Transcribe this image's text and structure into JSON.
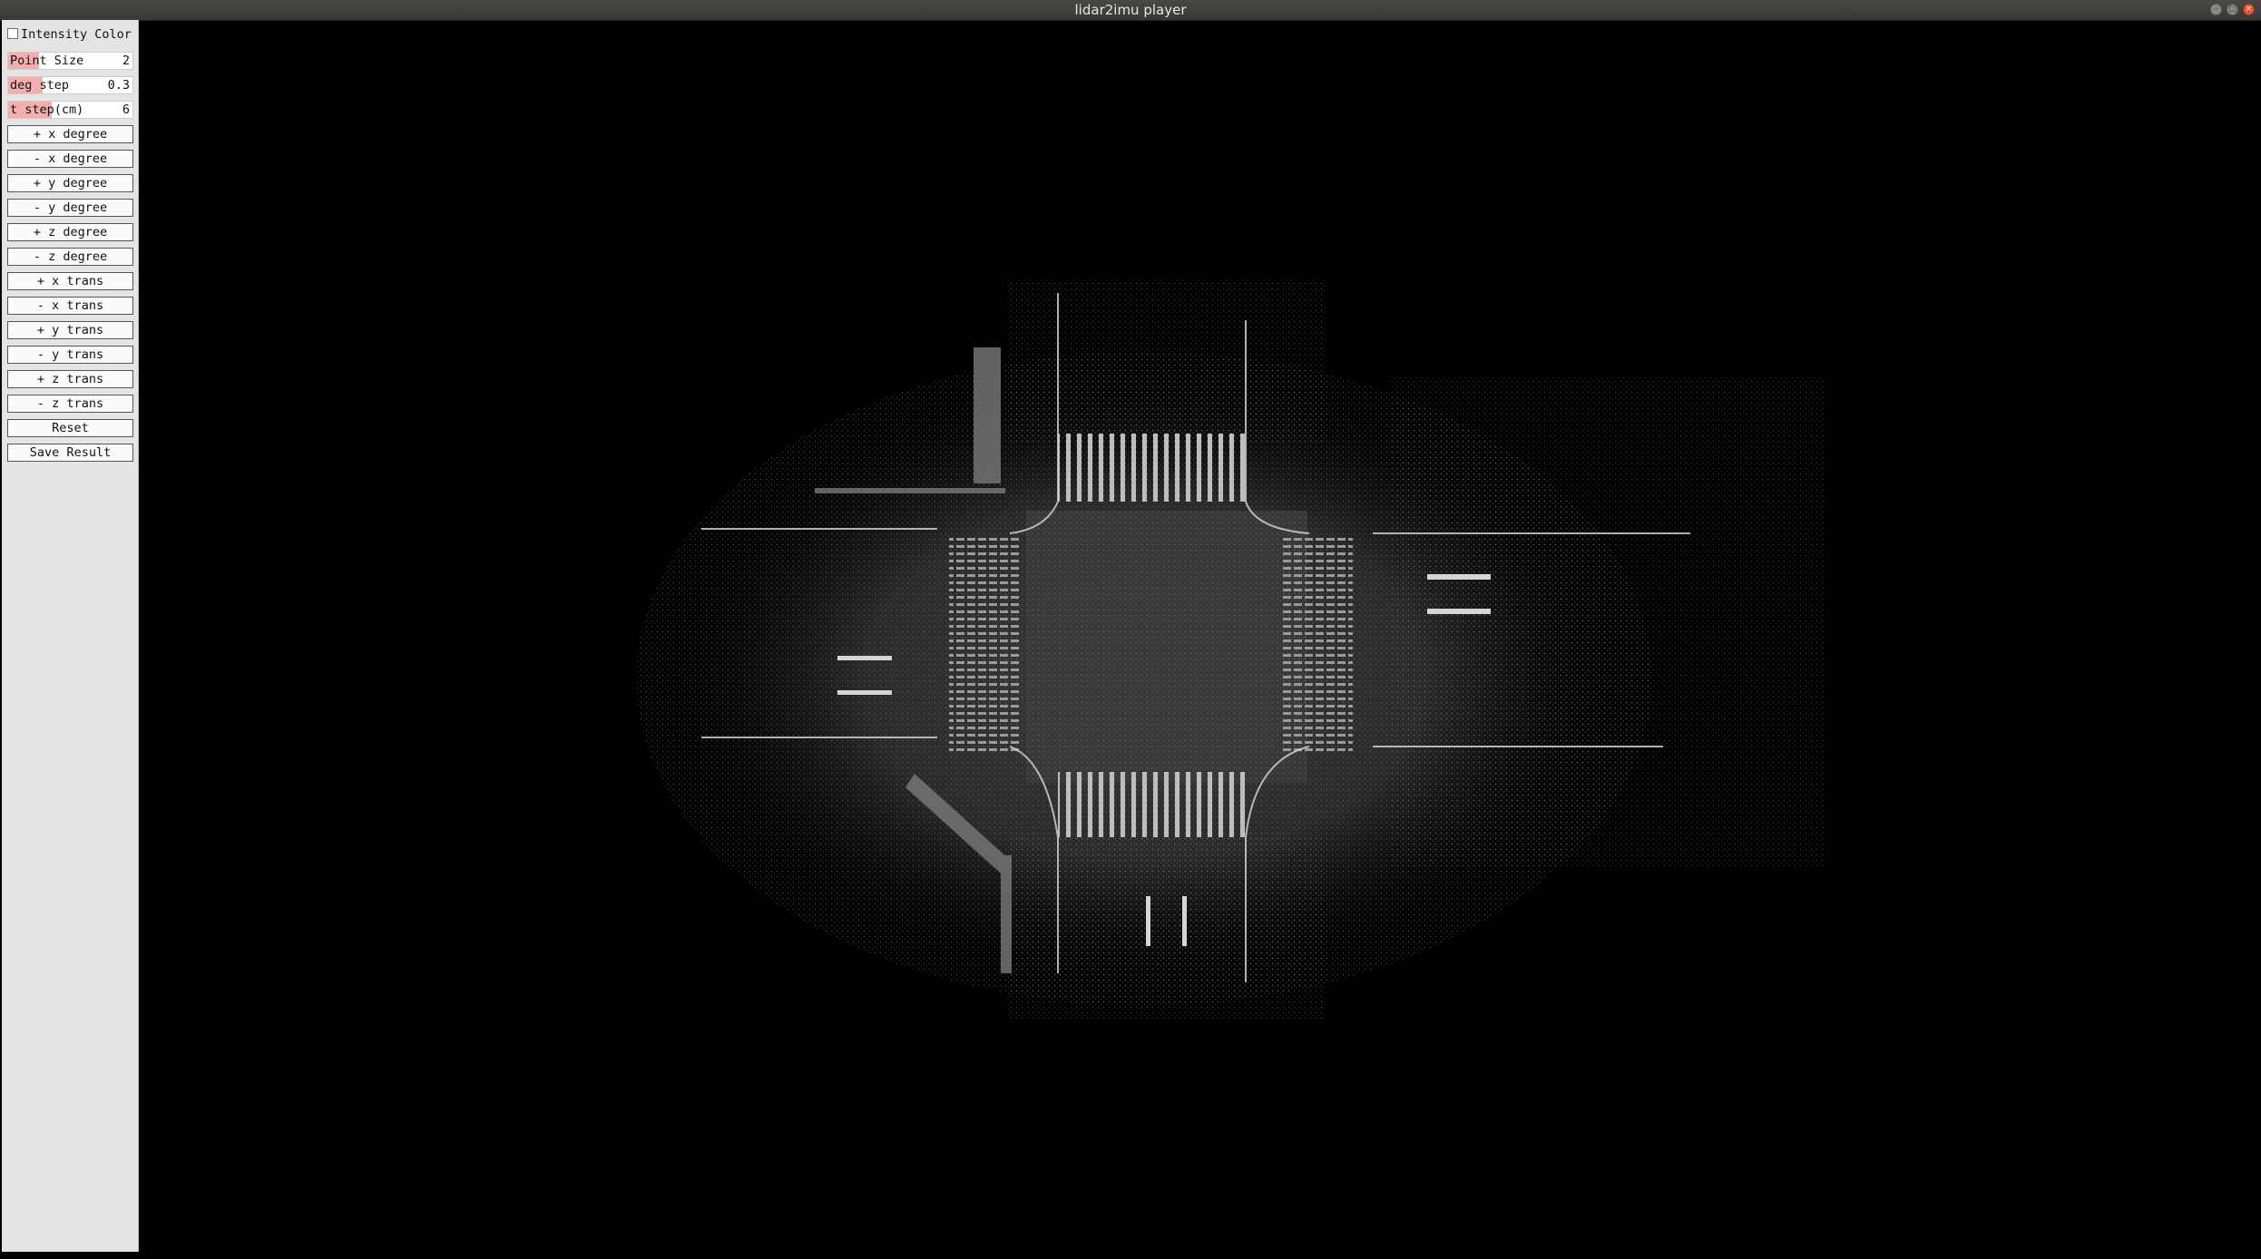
{
  "window": {
    "title": "lidar2imu player",
    "minimize_icon": "minimize-icon",
    "maximize_icon": "maximize-icon",
    "close_icon": "close-icon"
  },
  "panel": {
    "intensity_checkbox": {
      "label": "Intensity Color",
      "checked": false
    },
    "sliders": [
      {
        "label": "Point Size",
        "value": "2",
        "fill": 0.25
      },
      {
        "label": "deg step",
        "value": "0.3",
        "fill": 0.28
      },
      {
        "label": "t step(cm)",
        "value": "6",
        "fill": 0.35
      }
    ],
    "buttons": [
      "+ x degree",
      "- x degree",
      "+ y degree",
      "- y degree",
      "+ z degree",
      "- z degree",
      "+ x trans",
      "- x trans",
      "+ y trans",
      "- y trans",
      "+ z trans",
      "- z trans",
      "Reset",
      "Save Result"
    ]
  },
  "viewport": {
    "content": "lidar point cloud top-down view of road intersection",
    "background": "#000000",
    "point_color": "#d8d8d8"
  }
}
